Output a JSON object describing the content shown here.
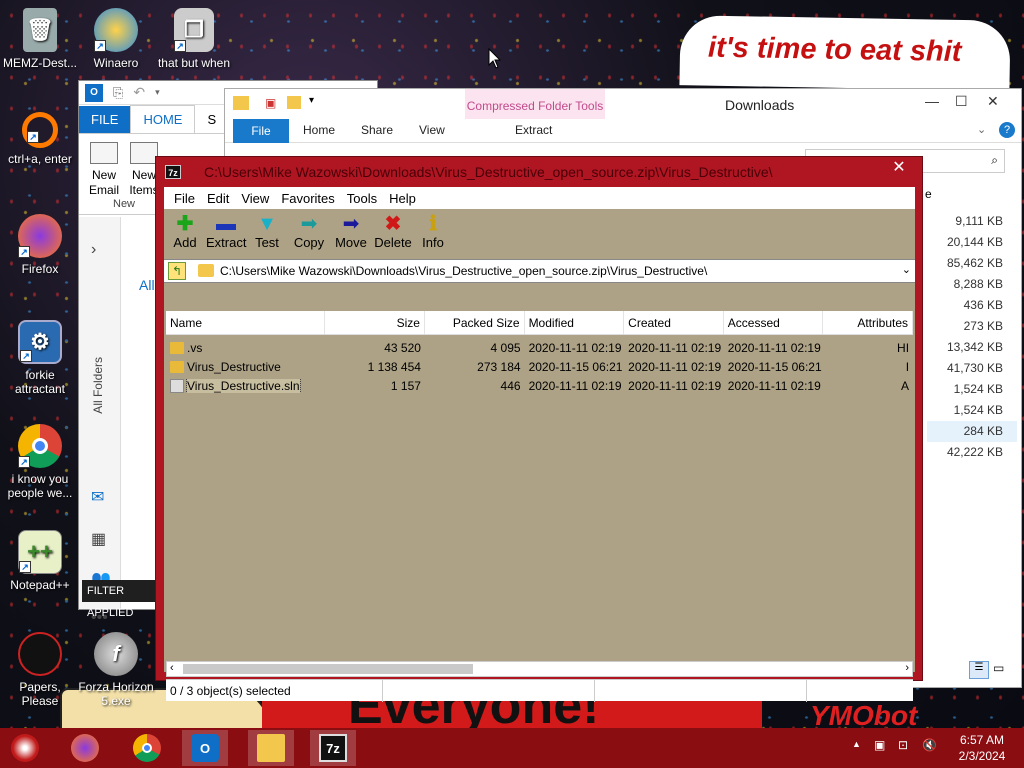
{
  "desktop": {
    "icons": [
      {
        "label": "MEMZ-Dest...",
        "icon": "recycle-bin-icon"
      },
      {
        "label": "Winaero",
        "icon": "winaero-icon"
      },
      {
        "label": "that but when",
        "icon": "copy-icon"
      },
      {
        "label": "ctrl+a, enter",
        "icon": "ring-icon"
      },
      {
        "label": "Firefox",
        "icon": "firefox-icon"
      },
      {
        "label": "forkie attractant",
        "icon": "settings-monitor-icon"
      },
      {
        "label": "i know you people we...",
        "icon": "chrome-icon"
      },
      {
        "label": "Notepad++",
        "icon": "notepad-plus-plus-icon"
      },
      {
        "label": "Papers, Please",
        "icon": "papers-please-icon"
      },
      {
        "label": "Forza Horizon 5.exe",
        "icon": "flash-icon"
      }
    ],
    "meme_top": "it's time to eat shit",
    "meme_bottom": "Everyone!",
    "corner_text": "YMObot"
  },
  "outlook": {
    "tabs": {
      "file": "FILE",
      "home": "HOME",
      "send": "S"
    },
    "new_email": "New Email",
    "new_items": "New Items",
    "group_new": "New",
    "all_folders": "All Folders",
    "all_label": "All",
    "filter_banner": "FILTER APPLIED"
  },
  "explorer": {
    "title": "Downloads",
    "context_tab": "Compressed Folder Tools",
    "tabs": {
      "file": "File",
      "home": "Home",
      "share": "Share",
      "view": "View",
      "extract": "Extract"
    },
    "sizes": [
      "9,111 KB",
      "20,144 KB",
      "85,462 KB",
      "8,288 KB",
      "436 KB",
      "273 KB",
      "13,342 KB",
      "41,730 KB",
      "1,524 KB",
      "1,524 KB",
      "284 KB",
      "42,222 KB"
    ],
    "size_header": "e"
  },
  "zip": {
    "title": "C:\\Users\\Mike Wazowski\\Downloads\\Virus_Destructive_open_source.zip\\Virus_Destructive\\",
    "menu": [
      "File",
      "Edit",
      "View",
      "Favorites",
      "Tools",
      "Help"
    ],
    "toolbar": [
      {
        "label": "Add",
        "icon": "add-icon"
      },
      {
        "label": "Extract",
        "icon": "extract-icon"
      },
      {
        "label": "Test",
        "icon": "test-icon"
      },
      {
        "label": "Copy",
        "icon": "copy-arrow-icon"
      },
      {
        "label": "Move",
        "icon": "move-arrow-icon"
      },
      {
        "label": "Delete",
        "icon": "delete-x-icon"
      },
      {
        "label": "Info",
        "icon": "info-icon"
      }
    ],
    "address": "C:\\Users\\Mike Wazowski\\Downloads\\Virus_Destructive_open_source.zip\\Virus_Destructive\\",
    "columns": [
      "Name",
      "Size",
      "Packed Size",
      "Modified",
      "Created",
      "Accessed",
      "Attributes"
    ],
    "rows": [
      {
        "name": ".vs",
        "size": "43 520",
        "packed": "4 095",
        "modified": "2020-11-11 02:19",
        "created": "2020-11-11 02:19",
        "accessed": "2020-11-11 02:19",
        "attr": "HI",
        "type": "folder"
      },
      {
        "name": "Virus_Destructive",
        "size": "1 138 454",
        "packed": "273 184",
        "modified": "2020-11-15 06:21",
        "created": "2020-11-11 02:19",
        "accessed": "2020-11-15 06:21",
        "attr": "I",
        "type": "folder"
      },
      {
        "name": "Virus_Destructive.sln",
        "size": "1 157",
        "packed": "446",
        "modified": "2020-11-11 02:19",
        "created": "2020-11-11 02:19",
        "accessed": "2020-11-11 02:19",
        "attr": "A",
        "type": "sln"
      }
    ],
    "status": "0 / 3 object(s) selected"
  },
  "taskbar": {
    "apps": [
      "start-button",
      "firefox-icon",
      "chrome-icon",
      "outlook-icon",
      "file-explorer-icon",
      "sevenzip-icon"
    ],
    "time": "6:57 AM",
    "date": "2/3/2024"
  },
  "colors": {
    "zip_border": "#b01522",
    "zip_bg": "#ada286",
    "taskbar": "#8a0d12",
    "accent": "#1979ca"
  }
}
